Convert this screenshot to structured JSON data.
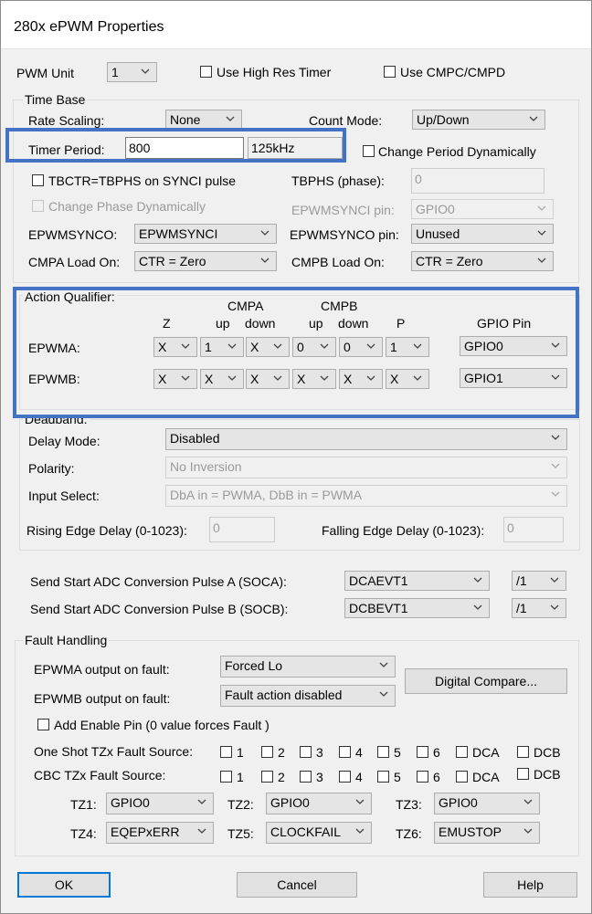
{
  "window": {
    "title": "280x ePWM Properties"
  },
  "top": {
    "pwm_unit_label": "PWM Unit",
    "pwm_unit_value": "1",
    "use_high_res_label": "Use High Res Timer",
    "use_cmpc_label": "Use CMPC/CMPD"
  },
  "time_base": {
    "title": "Time Base",
    "rate_scaling_label": "Rate Scaling:",
    "rate_scaling_value": "None",
    "count_mode_label": "Count Mode:",
    "count_mode_value": "Up/Down",
    "timer_period_label": "Timer Period:",
    "timer_period_value": "800",
    "timer_period_freq": "125kHz",
    "change_period_label": "Change Period Dynamically",
    "tbctr_label": "TBCTR=TBPHS on SYNCI pulse",
    "tbphs_label": "TBPHS (phase):",
    "tbphs_value": "0",
    "change_phase_label": "Change Phase Dynamically",
    "epwmsynci_pin_label": "EPWMSYNCI pin:",
    "epwmsynci_pin_value": "GPIO0",
    "epwmsynco_label": "EPWMSYNCO:",
    "epwmsynco_value": "EPWMSYNCI",
    "epwmsynco_pin_label": "EPWMSYNCO pin:",
    "epwmsynco_pin_value": "Unused",
    "cmpa_load_label": "CMPA Load On:",
    "cmpa_load_value": "CTR = Zero",
    "cmpb_load_label": "CMPB Load On:",
    "cmpb_load_value": "CTR = Zero"
  },
  "action_qualifier": {
    "title": "Action Qualifier:",
    "header_cmpa": "CMPA",
    "header_cmpb": "CMPB",
    "col_z": "Z",
    "col_up": "up",
    "col_down": "down",
    "col_p": "P",
    "col_gpio": "GPIO Pin",
    "rows": [
      {
        "label": "EPWMA:",
        "values": [
          "X",
          "1",
          "X",
          "0",
          "0",
          "1"
        ],
        "gpio": "GPIO0"
      },
      {
        "label": "EPWMB:",
        "values": [
          "X",
          "X",
          "X",
          "X",
          "X",
          "X"
        ],
        "gpio": "GPIO1"
      }
    ]
  },
  "deadband": {
    "title": "Deadband:",
    "delay_mode_label": "Delay Mode:",
    "delay_mode_value": "Disabled",
    "polarity_label": "Polarity:",
    "polarity_value": "No Inversion",
    "input_select_label": "Input Select:",
    "input_select_value": "DbA in = PWMA, DbB in = PWMA",
    "rising_label": "Rising Edge Delay (0-1023):",
    "rising_value": "0",
    "falling_label": "Falling Edge Delay (0-1023):",
    "falling_value": "0"
  },
  "adc": {
    "soca_label": "Send Start ADC Conversion Pulse A (SOCA):",
    "soca_value": "DCAEVT1",
    "soca_div": "/1",
    "socb_label": "Send Start ADC Conversion Pulse B (SOCB):",
    "socb_value": "DCBEVT1",
    "socb_div": "/1"
  },
  "fault": {
    "title": "Fault Handling",
    "epwma_label": "EPWMA output on fault:",
    "epwma_value": "Forced Lo",
    "epwmb_label": "EPWMB output on fault:",
    "epwmb_value": "Fault action disabled",
    "digital_compare_label": "Digital Compare...",
    "add_enable_label": "Add Enable Pin (0 value forces Fault )",
    "one_shot_label": "One Shot TZx Fault Source:",
    "cbc_label": "CBC TZx Fault Source:",
    "sources": [
      "1",
      "2",
      "3",
      "4",
      "5",
      "6",
      "DCA",
      "DCB"
    ],
    "tz": [
      {
        "label": "TZ1:",
        "value": "GPIO0"
      },
      {
        "label": "TZ2:",
        "value": "GPIO0"
      },
      {
        "label": "TZ3:",
        "value": "GPIO0"
      },
      {
        "label": "TZ4:",
        "value": "EQEPxERR"
      },
      {
        "label": "TZ5:",
        "value": "CLOCKFAIL"
      },
      {
        "label": "TZ6:",
        "value": "EMUSTOP"
      }
    ]
  },
  "buttons": {
    "ok": "OK",
    "cancel": "Cancel",
    "help": "Help"
  },
  "colors": {
    "highlight": "#4472c4",
    "default_button": "#0078d7"
  }
}
